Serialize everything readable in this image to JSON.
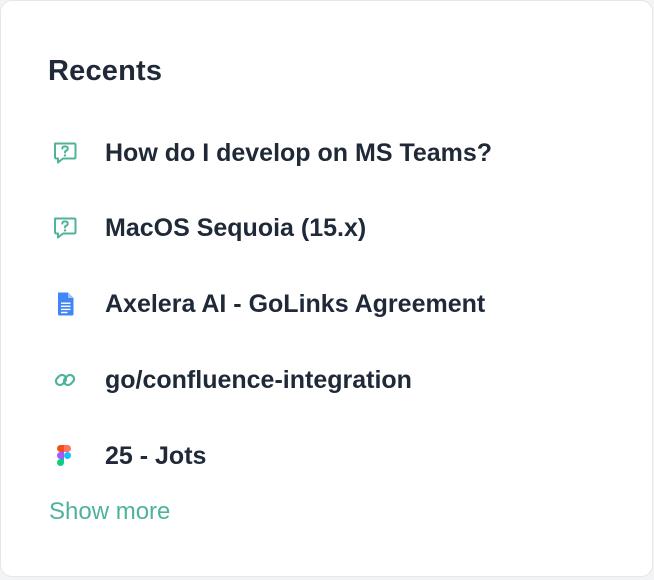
{
  "recents": {
    "title": "Recents",
    "items": [
      {
        "label": "How do I develop on MS Teams?",
        "icon": "question-chat-icon"
      },
      {
        "label": "MacOS Sequoia (15.x)",
        "icon": "question-chat-icon"
      },
      {
        "label": "Axelera AI - GoLinks Agreement",
        "icon": "google-docs-icon"
      },
      {
        "label": "go/confluence-integration",
        "icon": "golink-icon"
      },
      {
        "label": "25 - Jots",
        "icon": "figma-icon"
      }
    ],
    "show_more": "Show more"
  },
  "colors": {
    "accent": "#4fb39b",
    "text": "#1f2937",
    "docs_blue": "#4285f4"
  }
}
